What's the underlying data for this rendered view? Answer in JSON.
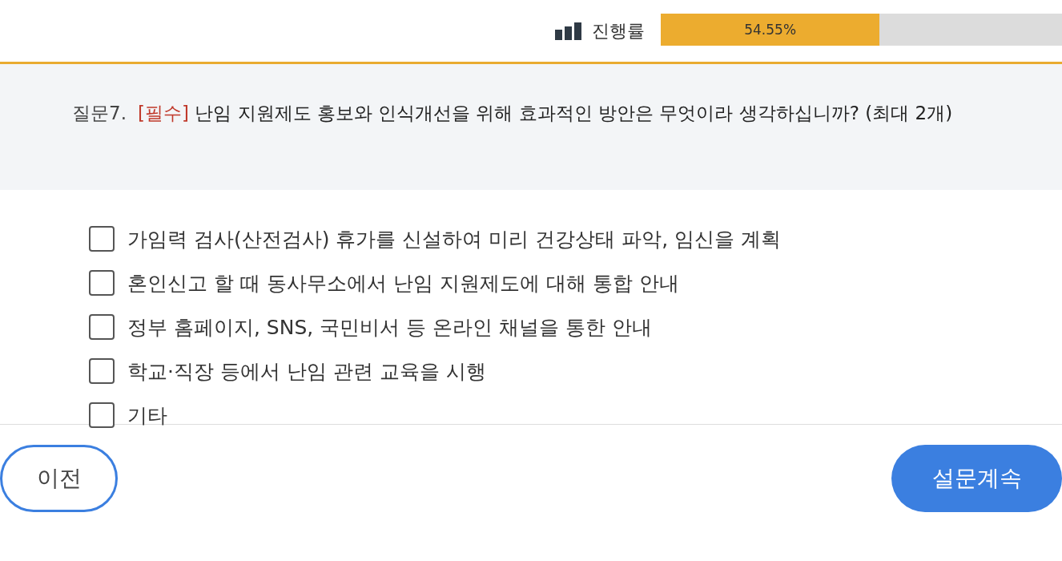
{
  "progress": {
    "label": "진행률",
    "level": 0.5455,
    "reading": "54.55%"
  },
  "question": {
    "number": "질문7.",
    "required": "[필수]",
    "text": "난임 지원제도 홍보와 인식개선을 위해 효과적인 방안은 무엇이라 생각하십니까? (최대 2개)"
  },
  "options": [
    {
      "label": "가임력 검사(산전검사) 휴가를 신설하여 미리 건강상태 파악, 임신을 계획",
      "checked": false
    },
    {
      "label": "혼인신고 할 때 동사무소에서 난임 지원제도에 대해 통합 안내",
      "checked": false
    },
    {
      "label": "정부 홈페이지, SNS, 국민비서 등 온라인 채널을 통한 안내",
      "checked": false
    },
    {
      "label": "학교·직장 등에서 난임 관련 교육을 시행",
      "checked": false
    },
    {
      "label": "기타",
      "checked": false
    }
  ],
  "buttons": {
    "previous": "이전",
    "next": "설문계속"
  }
}
